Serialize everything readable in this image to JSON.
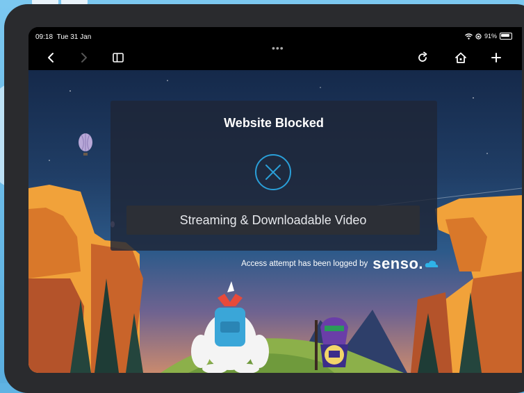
{
  "status_bar": {
    "time": "09:18",
    "date": "Tue 31 Jan",
    "battery": "91%"
  },
  "toolbar": {
    "back_icon": "chevron-left-icon",
    "forward_icon": "chevron-right-icon",
    "sidebar_icon": "sidebar-icon",
    "more_label": "•••",
    "reload_icon": "reload-icon",
    "home_icon": "home-icon",
    "new_tab_icon": "plus-icon"
  },
  "block_page": {
    "title": "Website Blocked",
    "category": "Streaming & Downloadable Video",
    "logged_text": "Access attempt has been logged by",
    "brand": "senso.",
    "colors": {
      "icon_ring": "#2a9fd8",
      "brand_cloud": "#2fb3e8"
    }
  }
}
